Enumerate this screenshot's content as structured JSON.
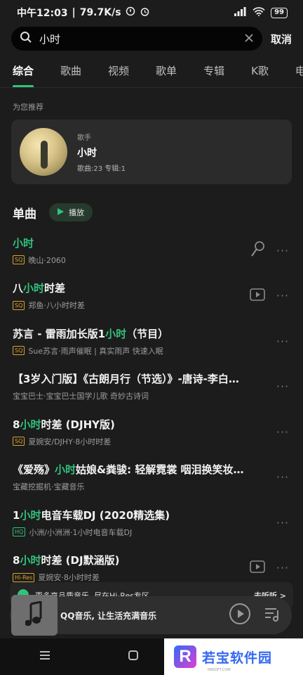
{
  "status": {
    "time": "中午12:03",
    "speed": "79.7K/s",
    "battery": "99"
  },
  "search": {
    "query": "小时",
    "cancel": "取消"
  },
  "tabs": [
    "综合",
    "歌曲",
    "视频",
    "歌单",
    "专辑",
    "K歌",
    "电"
  ],
  "recommend": {
    "label": "为您推荐",
    "kind": "歌手",
    "name": "小时",
    "stats": "歌曲:23 专辑:1"
  },
  "singles": {
    "title": "单曲",
    "play": "播放"
  },
  "songs": [
    {
      "pre": "",
      "hl": "小时",
      "post": "",
      "quality": "SQ",
      "sub": "晚山·2060",
      "extra": "mic"
    },
    {
      "pre": "八",
      "hl": "小时",
      "post": "时差",
      "quality": "SQ",
      "sub": "郑鱼·八小时时差",
      "extra": "video"
    },
    {
      "pre": "苏言 - 雷雨加长版1",
      "hl": "小时",
      "post": "（节目）",
      "quality": "SQ",
      "sub": "Sue苏言·雨声催眠 | 真实雨声 快速入眠",
      "extra": ""
    },
    {
      "pre": "【3岁入门版】《古朗月行（节选）》-唐诗-李白…",
      "hl": "",
      "post": "",
      "quality": "",
      "sub": "宝宝巴士·宝宝巴士国学儿歌 奇妙古诗词",
      "extra": ""
    },
    {
      "pre": "8",
      "hl": "小时",
      "post": "时差 (DJHY版)",
      "quality": "SQ",
      "sub": "夏婉安/DJHY·8小时时差",
      "extra": ""
    },
    {
      "pre": "《爱殇》",
      "hl": "小时",
      "post": "姑娘&粪骏: 轻解霓裳 咽泪换笑妆…",
      "quality": "",
      "sub": "宝藏挖掘机·宝藏音乐",
      "extra": ""
    },
    {
      "pre": "1",
      "hl": "小时",
      "post": "电音车载DJ (2020精选集)",
      "quality": "HQ",
      "sub": "小洲/小洲洲·1小时电音车载DJ",
      "extra": ""
    },
    {
      "pre": "8",
      "hl": "小时",
      "post": "时差 (DJ默涵版)",
      "quality": "Hi-Res",
      "sub": "夏婉安·8小时时差",
      "extra": "video"
    }
  ],
  "banner": {
    "text": "更多高品质音乐, 尽在Hi-Res专区",
    "action": "去听听 >"
  },
  "player": {
    "title": "QQ音乐, 让生活充满音乐"
  },
  "watermark": {
    "logo": "R",
    "name": "若宝软件园",
    "site": "RBSOFT.COM"
  },
  "colors": {
    "accent": "#31c27c",
    "background": "#1c1c1c"
  }
}
